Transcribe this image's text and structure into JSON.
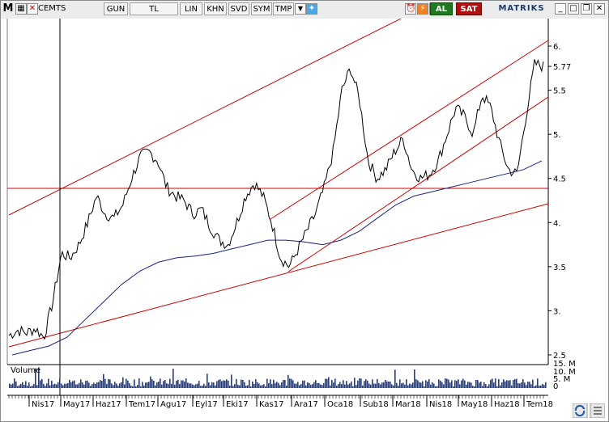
{
  "toolbar": {
    "app_letter": "M",
    "symbol": "CEMTS",
    "period": "GUN",
    "currency": "TL",
    "buttons": [
      "LIN",
      "KHN",
      "SVD",
      "SYM",
      "TMP"
    ],
    "buy": "AL",
    "sell": "SAT",
    "brand": "MATRIKS"
  },
  "chart_data": {
    "type": "line",
    "title": "",
    "price_axis_ticks": [
      "6.",
      "5.77",
      "5.5",
      "5.",
      "4.5",
      "4.",
      "3.5",
      "3.",
      "2.5"
    ],
    "current_value": "5.77",
    "volume_label": "Volume",
    "volume_axis_ticks": [
      "15. M",
      "10. M",
      "5. M",
      "0"
    ],
    "x_tick_labels": [
      "Nis17",
      "May17",
      "Haz17",
      "Tem17",
      "Agu17",
      "Eyl17",
      "Eki17",
      "Kas17",
      "Ara17",
      "Oca18",
      "Sub18",
      "Mar18",
      "Nis18",
      "May18",
      "Haz18",
      "Tem18"
    ],
    "ylim": [
      2.5,
      6.2
    ],
    "price_series_approx": [
      2.72,
      2.78,
      2.75,
      2.8,
      2.7,
      3.1,
      3.65,
      3.6,
      3.75,
      4.0,
      4.3,
      4.1,
      4.05,
      4.2,
      4.5,
      4.75,
      4.8,
      4.7,
      4.4,
      4.3,
      4.25,
      4.1,
      4.15,
      3.95,
      3.8,
      3.75,
      4.0,
      4.3,
      4.45,
      4.3,
      4.0,
      3.6,
      3.5,
      3.7,
      3.9,
      4.1,
      4.4,
      4.8,
      5.5,
      5.75,
      5.4,
      4.7,
      4.5,
      4.6,
      4.8,
      4.95,
      4.6,
      4.5,
      4.55,
      4.7,
      5.0,
      5.3,
      5.2,
      5.0,
      5.45,
      5.3,
      4.9,
      4.6,
      4.55,
      5.2,
      5.8,
      5.77
    ],
    "moving_average_approx": [
      2.5,
      2.55,
      2.6,
      2.7,
      2.9,
      3.1,
      3.3,
      3.45,
      3.55,
      3.6,
      3.62,
      3.65,
      3.7,
      3.75,
      3.8,
      3.8,
      3.78,
      3.75,
      3.8,
      3.9,
      4.05,
      4.2,
      4.3,
      4.35,
      4.4,
      4.45,
      4.5,
      4.55,
      4.6,
      4.7
    ]
  },
  "colors": {
    "price": "#000000",
    "moving_average": "#1a237e",
    "trendline": "#cc0000",
    "volume": "#1e3c8c",
    "buy_bg": "#1f7a1f",
    "sell_bg": "#b01010"
  }
}
